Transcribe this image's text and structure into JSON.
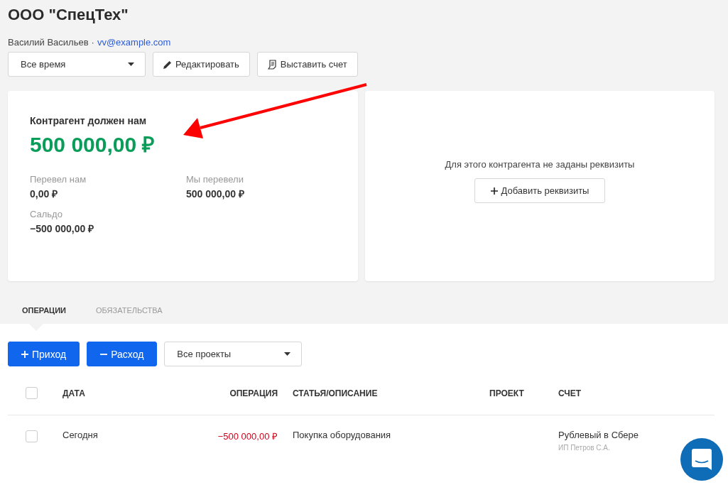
{
  "header": {
    "title": "ООО \"СпецТех\"",
    "contact_name": "Василий Васильев",
    "separator": "·",
    "email": "vv@example.com"
  },
  "toolbar": {
    "period_select": {
      "value": "Все время"
    },
    "buttons": [
      {
        "label": "Редактировать",
        "kind": "edit"
      },
      {
        "label": "Выставить счет",
        "kind": "invoice"
      }
    ]
  },
  "balance_card": {
    "heading": "Контрагент должен нам",
    "amount": "500 000,00 ₽",
    "stats": [
      {
        "label": "Перевел нам",
        "value": "0,00 ₽"
      },
      {
        "label": "Мы перевели",
        "value": "500 000,00 ₽"
      },
      {
        "label": "Сальдо",
        "value": "−500 000,00 ₽"
      }
    ]
  },
  "requisites_card": {
    "message": "Для этого контрагента не заданы реквизиты",
    "button": "Добавить реквизиты"
  },
  "tabs": [
    {
      "label": "ОПЕРАЦИИ",
      "selected": true
    },
    {
      "label": "ОБЯЗАТЕЛЬСТВА",
      "selected": false
    }
  ],
  "actions": {
    "buttons": [
      {
        "label": "Приход",
        "kind": "income"
      },
      {
        "label": "Расход",
        "kind": "expense"
      }
    ],
    "project_select": {
      "value": "Все проекты"
    }
  },
  "table": {
    "select_all_checked": false,
    "columns": [
      {
        "label": "ДАТА"
      },
      {
        "label": "ОПЕРАЦИЯ"
      },
      {
        "label": "СТАТЬЯ/ОПИСАНИЕ"
      },
      {
        "label": "ПРОЕКТ"
      },
      {
        "label": "СЧЕТ"
      }
    ],
    "rows": [
      {
        "checked": false,
        "date": "Сегодня",
        "operation": "−500 000,00 ₽",
        "color": "#d0021b",
        "description": "Покупка оборудования",
        "account": "Рублевый в Сбере",
        "account_owner": "ИП Петров С.А."
      }
    ]
  }
}
